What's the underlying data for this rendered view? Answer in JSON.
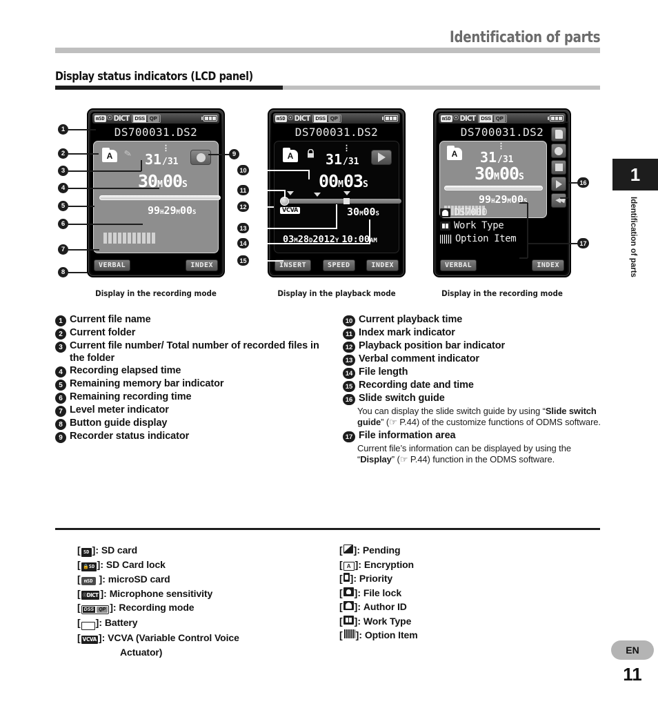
{
  "header": {
    "title": "Identification of parts"
  },
  "section": {
    "heading": "Display status indicators (LCD panel)"
  },
  "side": {
    "chapter_number": "1",
    "chapter_label": "Identification of parts",
    "language_badge": "EN",
    "page_number": "11"
  },
  "panels": [
    {
      "caption": "Display in the recording mode",
      "statusbar": {
        "card": "mSD",
        "mic": "DICT",
        "mode_a": "DSS",
        "mode_b": "QP"
      },
      "filename": "DS700031.DS2",
      "folder": "A",
      "file_number": "31",
      "file_total": "/31",
      "elapsed_num1": "30",
      "elapsed_unit1": "M",
      "elapsed_num2": "00",
      "elapsed_unit2": "S",
      "remaining": [
        {
          "n": "99",
          "u": "H"
        },
        {
          "n": "29",
          "u": "M"
        },
        {
          "n": "00",
          "u": "S"
        }
      ],
      "buttons": [
        "VERBAL",
        "INDEX"
      ]
    },
    {
      "caption": "Display in the playback mode",
      "statusbar": {
        "card": "mSD",
        "mic": "DICT",
        "mode_a": "DSS",
        "mode_b": "QP"
      },
      "filename": "DS700031.DS2",
      "folder": "A",
      "file_number": "31",
      "file_total": "/31",
      "playback_num1": "00",
      "playback_unit1": "M",
      "playback_num2": "03",
      "playback_unit2": "S",
      "vcva": "VCVA",
      "length_num1": "30",
      "length_unit1": "M",
      "length_num2": "00",
      "length_unit2": "S",
      "datetime": [
        {
          "n": "03",
          "u": "M"
        },
        {
          "n": "28",
          "u": "D"
        },
        {
          "n": "2012",
          "u": "Y"
        },
        {
          "n": "10:00",
          "u": "AM"
        }
      ],
      "buttons": [
        "INSERT",
        "SPEED",
        "INDEX"
      ]
    },
    {
      "caption": "Display in the recording mode",
      "statusbar": {
        "card": "mSD",
        "mic": "DICT",
        "mode_a": "DSS",
        "mode_b": "QP"
      },
      "filename": "DS700031.DS2",
      "folder": "A",
      "file_number": "31",
      "file_total": "/31",
      "elapsed_num1": "30",
      "elapsed_unit1": "M",
      "elapsed_num2": "00",
      "elapsed_unit2": "S",
      "remaining": [
        {
          "n": "99",
          "u": "H"
        },
        {
          "n": "29",
          "u": "M"
        },
        {
          "n": "00",
          "u": "S"
        }
      ],
      "file_info": [
        {
          "icon": "author-id-icon",
          "label": "DS7000"
        },
        {
          "icon": "work-type-icon",
          "label": "Work Type"
        },
        {
          "icon": "option-item-icon",
          "label": "Option Item"
        }
      ],
      "slide_switch_icons": [
        "page-icon",
        "record-icon",
        "stop-icon",
        "play-icon",
        "rewind-icon"
      ],
      "buttons": [
        "VERBAL",
        "INDEX"
      ]
    }
  ],
  "legend_left": [
    {
      "num": "1",
      "text": "Current file name"
    },
    {
      "num": "2",
      "text": "Current folder"
    },
    {
      "num": "3",
      "text": "Current file number/ Total number of recorded files in the folder"
    },
    {
      "num": "4",
      "text": "Recording elapsed time"
    },
    {
      "num": "5",
      "text": "Remaining memory bar indicator"
    },
    {
      "num": "6",
      "text": "Remaining recording time"
    },
    {
      "num": "7",
      "text": "Level meter indicator"
    },
    {
      "num": "8",
      "text": "Button guide display"
    },
    {
      "num": "9",
      "text": "Recorder status indicator"
    }
  ],
  "legend_right": [
    {
      "num": "10",
      "text": "Current playback time"
    },
    {
      "num": "11",
      "text": "Index mark indicator"
    },
    {
      "num": "12",
      "text": "Playback position bar indicator"
    },
    {
      "num": "13",
      "text": "Verbal comment indicator"
    },
    {
      "num": "14",
      "text": "File length"
    },
    {
      "num": "15",
      "text": "Recording date and time"
    },
    {
      "num": "16",
      "text": "Slide switch guide",
      "desc_parts": [
        "You can display the slide switch guide by using “",
        "Slide switch guide",
        "” (☞ P.44) of the customize functions of ODMS software."
      ]
    },
    {
      "num": "17",
      "text": "File information area",
      "desc_parts": [
        "Current file’s information can be displayed by using the “",
        "Display",
        "” (☞ P.44) function in the ODMS software."
      ]
    }
  ],
  "glossary_left": [
    {
      "icon": "sd-card-icon",
      "label": "SD card"
    },
    {
      "icon": "sd-card-lock-icon",
      "label": "SD Card lock"
    },
    {
      "icon": "microsd-card-icon",
      "label": "microSD card"
    },
    {
      "icon": "microphone-sensitivity-icon",
      "label": "Microphone sensitivity"
    },
    {
      "icon": "recording-mode-icon",
      "label": "Recording mode"
    },
    {
      "icon": "battery-icon",
      "label": "Battery"
    },
    {
      "icon": "vcva-icon",
      "label": "VCVA (Variable Control Voice"
    },
    {
      "icon": "",
      "label": "Actuator)"
    }
  ],
  "glossary_right": [
    {
      "icon": "pending-icon",
      "label": "Pending"
    },
    {
      "icon": "encryption-icon",
      "label": "Encryption"
    },
    {
      "icon": "priority-icon",
      "label": "Priority"
    },
    {
      "icon": "file-lock-icon",
      "label": "File lock"
    },
    {
      "icon": "author-id-icon",
      "label": "Author ID"
    },
    {
      "icon": "work-type-icon",
      "label": "Work Type"
    },
    {
      "icon": "option-item-icon",
      "label": "Option Item"
    }
  ],
  "colors": {
    "rule_grey": "#bfbfbf",
    "ink": "#1d1d1d",
    "lcd_grey": "#8e8e8e",
    "badge_grey": "#b4b4b4"
  }
}
